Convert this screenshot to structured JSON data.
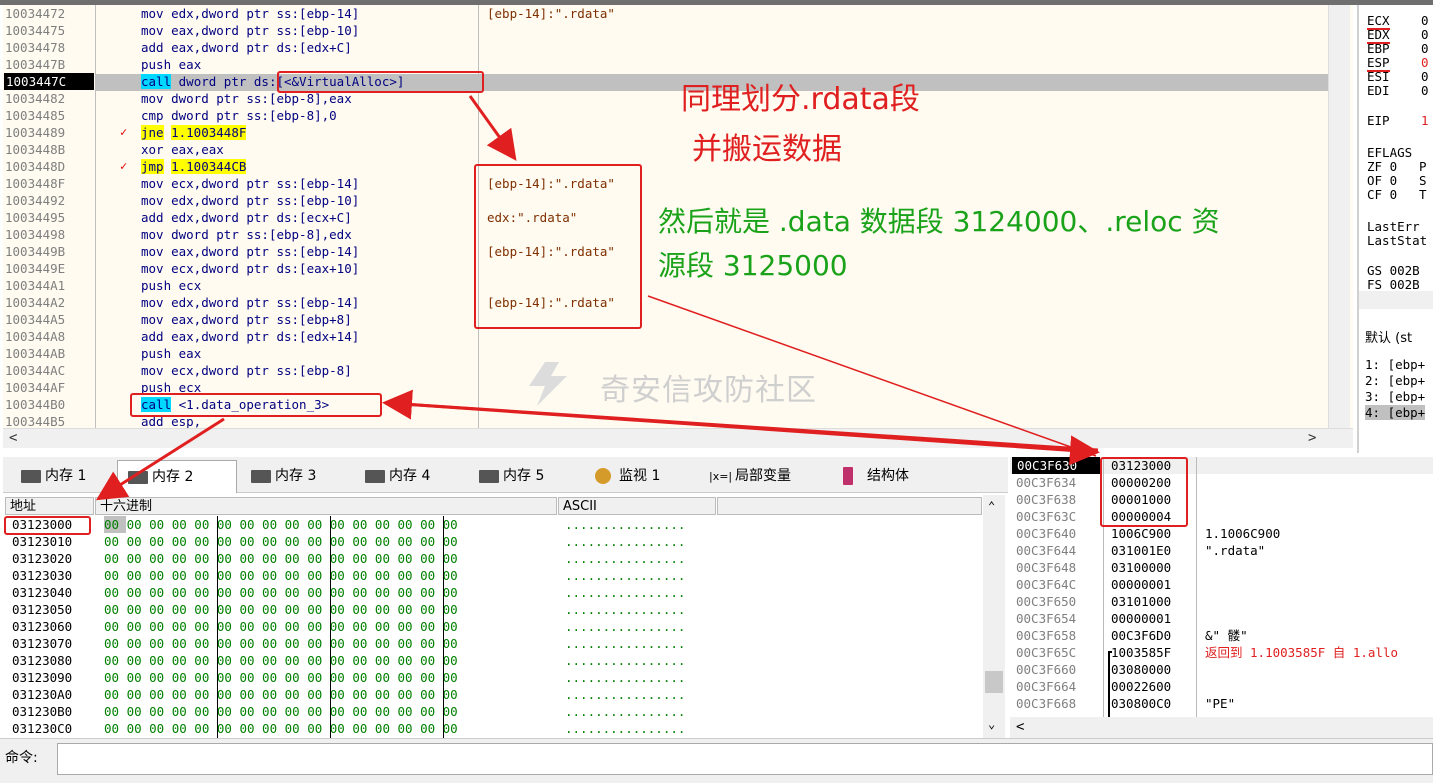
{
  "disasm": {
    "selected_row": 4,
    "rows": [
      {
        "addr": "10034472",
        "mn": "mov",
        "ops": "edx,dword ptr ss:[ebp-14]",
        "cmt": "[ebp-14]:\".rdata\""
      },
      {
        "addr": "10034475",
        "mn": "mov",
        "ops": "eax,dword ptr ss:[ebp-10]",
        "cmt": ""
      },
      {
        "addr": "10034478",
        "mn": "add",
        "ops": "eax,dword ptr ds:[edx+C]",
        "cmt": ""
      },
      {
        "addr": "1003447B",
        "mn": "push",
        "ops": "eax",
        "cmt": ""
      },
      {
        "addr": "1003447C",
        "mn": "call",
        "ops": "dword ptr ds:[<&VirtualAlloc>]",
        "cmt": ""
      },
      {
        "addr": "10034482",
        "mn": "mov",
        "ops": "dword ptr ss:[ebp-8],eax",
        "cmt": ""
      },
      {
        "addr": "10034485",
        "mn": "cmp",
        "ops": "dword ptr ss:[ebp-8],0",
        "cmt": ""
      },
      {
        "addr": "10034489",
        "mn": "jne",
        "ops": "1.1003448F",
        "cmt": ""
      },
      {
        "addr": "1003448B",
        "mn": "xor",
        "ops": "eax,eax",
        "cmt": ""
      },
      {
        "addr": "1003448D",
        "mn": "jmp",
        "ops": "1.100344CB",
        "cmt": ""
      },
      {
        "addr": "1003448F",
        "mn": "mov",
        "ops": "ecx,dword ptr ss:[ebp-14]",
        "cmt": "[ebp-14]:\".rdata\""
      },
      {
        "addr": "10034492",
        "mn": "mov",
        "ops": "edx,dword ptr ss:[ebp-10]",
        "cmt": ""
      },
      {
        "addr": "10034495",
        "mn": "add",
        "ops": "edx,dword ptr ds:[ecx+C]",
        "cmt": "edx:\".rdata\""
      },
      {
        "addr": "10034498",
        "mn": "mov",
        "ops": "dword ptr ss:[ebp-8],edx",
        "cmt": ""
      },
      {
        "addr": "1003449B",
        "mn": "mov",
        "ops": "eax,dword ptr ss:[ebp-14]",
        "cmt": "[ebp-14]:\".rdata\""
      },
      {
        "addr": "1003449E",
        "mn": "mov",
        "ops": "ecx,dword ptr ds:[eax+10]",
        "cmt": ""
      },
      {
        "addr": "100344A1",
        "mn": "push",
        "ops": "ecx",
        "cmt": ""
      },
      {
        "addr": "100344A2",
        "mn": "mov",
        "ops": "edx,dword ptr ss:[ebp-14]",
        "cmt": "[ebp-14]:\".rdata\""
      },
      {
        "addr": "100344A5",
        "mn": "mov",
        "ops": "eax,dword ptr ss:[ebp+8]",
        "cmt": ""
      },
      {
        "addr": "100344A8",
        "mn": "add",
        "ops": "eax,dword ptr ds:[edx+14]",
        "cmt": ""
      },
      {
        "addr": "100344AB",
        "mn": "push",
        "ops": "eax",
        "cmt": ""
      },
      {
        "addr": "100344AC",
        "mn": "mov",
        "ops": "ecx,dword ptr ss:[ebp-8]",
        "cmt": ""
      },
      {
        "addr": "100344AF",
        "mn": "push",
        "ops": "ecx",
        "cmt": ""
      },
      {
        "addr": "100344B0",
        "mn": "call",
        "ops": "<1.data_operation_3>",
        "cmt": ""
      },
      {
        "addr": "100344B5",
        "mn": "add",
        "ops": "esp,",
        "cmt": ""
      }
    ]
  },
  "registers": [
    {
      "name": "ECX",
      "val": "0"
    },
    {
      "name": "EDX",
      "val": "0"
    },
    {
      "name": "EBP",
      "val": "0"
    },
    {
      "name": "ESP",
      "val": "0"
    },
    {
      "name": "ESI",
      "val": "0"
    },
    {
      "name": "EDI",
      "val": "0"
    },
    {
      "name": "EIP",
      "val": "1"
    },
    {
      "name": "EFLAGS",
      "val": ""
    },
    {
      "name": "ZF 0",
      "val": "P"
    },
    {
      "name": "OF 0",
      "val": "S"
    },
    {
      "name": "CF 0",
      "val": "T"
    },
    {
      "name": "LastErr",
      "val": ""
    },
    {
      "name": "LastStat",
      "val": ""
    },
    {
      "name": "GS 002B",
      "val": ""
    },
    {
      "name": "FS 002B",
      "val": ""
    }
  ],
  "regs_extra": {
    "default_label": "默认 (st",
    "callstack": [
      "1: [ebp+",
      "2: [ebp+",
      "3: [ebp+",
      "4: [ebp+"
    ]
  },
  "tabs": [
    {
      "label": "内存 1",
      "active": false
    },
    {
      "label": "内存 2",
      "active": true
    },
    {
      "label": "内存 3",
      "active": false
    },
    {
      "label": "内存 4",
      "active": false
    },
    {
      "label": "内存 5",
      "active": false
    },
    {
      "label": "监视 1",
      "active": false
    },
    {
      "label": "局部变量",
      "active": false
    },
    {
      "label": "结构体",
      "active": false
    }
  ],
  "dump": {
    "col_addr": "地址",
    "col_hex": "十六进制",
    "col_ascii": "ASCII",
    "hex": "00 00 00 00 00 00 00 00 00 00 00 00 00 00 00 00",
    "ascii": "................",
    "addresses": [
      "03123000",
      "03123010",
      "03123020",
      "03123030",
      "03123040",
      "03123050",
      "03123060",
      "03123070",
      "03123080",
      "03123090",
      "031230A0",
      "031230B0",
      "031230C0"
    ]
  },
  "stack": [
    {
      "addr": "00C3F630",
      "val": "03123000",
      "cmt": ""
    },
    {
      "addr": "00C3F634",
      "val": "00000200",
      "cmt": ""
    },
    {
      "addr": "00C3F638",
      "val": "00001000",
      "cmt": ""
    },
    {
      "addr": "00C3F63C",
      "val": "00000004",
      "cmt": ""
    },
    {
      "addr": "00C3F640",
      "val": "1006C900",
      "cmt": "1.1006C900"
    },
    {
      "addr": "00C3F644",
      "val": "031001E0",
      "cmt": "\".rdata\""
    },
    {
      "addr": "00C3F648",
      "val": "03100000",
      "cmt": ""
    },
    {
      "addr": "00C3F64C",
      "val": "00000001",
      "cmt": ""
    },
    {
      "addr": "00C3F650",
      "val": "03101000",
      "cmt": ""
    },
    {
      "addr": "00C3F654",
      "val": "00000001",
      "cmt": ""
    },
    {
      "addr": "00C3F658",
      "val": "00C3F6D0",
      "cmt": "&\" 髅\""
    },
    {
      "addr": "00C3F65C",
      "val": "1003585F",
      "cmt": "返回到 1.1003585F 自 1.allo"
    },
    {
      "addr": "00C3F660",
      "val": "03080000",
      "cmt": ""
    },
    {
      "addr": "00C3F664",
      "val": "00022600",
      "cmt": ""
    },
    {
      "addr": "00C3F668",
      "val": "030800C0",
      "cmt": "\"PE\""
    }
  ],
  "command_label": "命令:",
  "annotations": {
    "note1_line1": "同理划分.rdata段",
    "note1_line2": "并搬运数据",
    "note2_line1": "然后就是 .data 数据段 3124000、.reloc 资",
    "note2_line2": "源段 3125000",
    "watermark": "奇安信攻防社区"
  }
}
